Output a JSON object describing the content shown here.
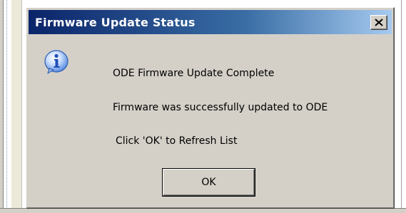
{
  "dialog": {
    "title": "Firmware Update Status",
    "close_icon": "close-x-icon",
    "icon": "information-icon",
    "messages": [
      "ODE Firmware Update Complete",
      "Firmware was successfully updated to ODE",
      "Click 'OK' to Refresh List"
    ],
    "ok_label": "OK"
  },
  "colors": {
    "dialog_face": "#d4d0c8",
    "titlebar_start": "#0a246a",
    "titlebar_end": "#a6caf0",
    "title_text": "#ffffff",
    "icon_blue": "#2f6fd6"
  }
}
